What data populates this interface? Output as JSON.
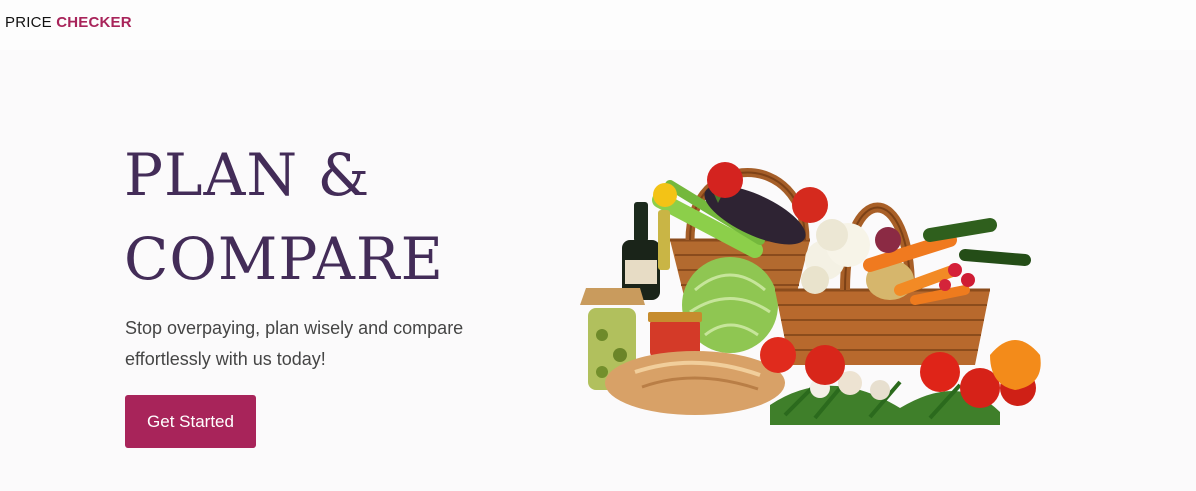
{
  "header": {
    "brand_primary": "PRICE",
    "brand_accent": "CHECKER"
  },
  "hero": {
    "title_line1": "PLAN &",
    "title_line2": "COMPARE",
    "subtitle_line1": "Stop overpaying, plan wisely and compare",
    "subtitle_line2": "effortlessly with us today!",
    "cta_label": "Get Started"
  },
  "colors": {
    "accent": "#a8245a",
    "title": "#432c58",
    "text": "#454545",
    "background": "#fbfafb"
  },
  "image": {
    "subject": "basket-of-groceries-illustration"
  }
}
